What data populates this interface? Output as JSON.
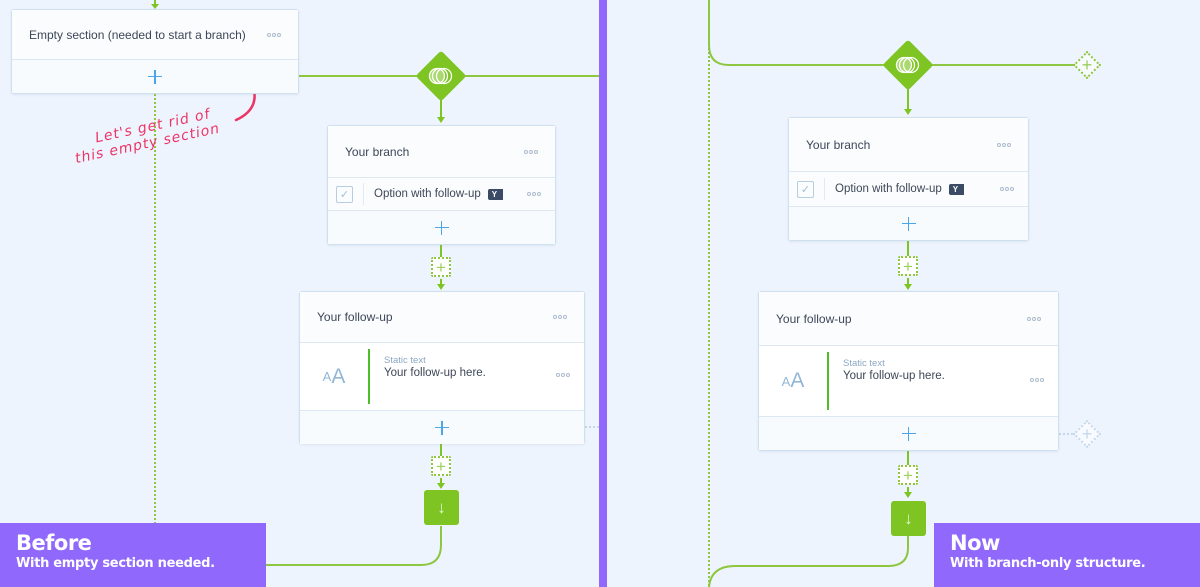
{
  "colors": {
    "background": "#edf4fd",
    "flow_green": "#7ec524",
    "accent_purple": "#9068fb",
    "annotation_pink": "#ec3566",
    "add_blue": "#4aa6e8"
  },
  "before": {
    "empty_section": {
      "title": "Empty section (needed to start a branch)",
      "menu_icon": "more-dots-icon",
      "add_icon": "plus-icon"
    },
    "annotation": {
      "line1": "Let's get rid of",
      "line2": "this empty section"
    },
    "branch_icon": "branch-circles-icon",
    "branch_card": {
      "title": "Your branch",
      "option": {
        "label": "Option with follow-up",
        "badge": "Y",
        "checked": true
      }
    },
    "followup_card": {
      "title": "Your follow-up",
      "block": {
        "type_label": "Static text",
        "value": "Your follow-up here.",
        "icon": "font-size-icon"
      }
    },
    "end_icon": "arrow-down-icon",
    "caption": {
      "title": "Before",
      "subtitle": "With empty section needed."
    }
  },
  "now": {
    "branch_icon": "branch-circles-icon",
    "branch_card": {
      "title": "Your branch",
      "option": {
        "label": "Option with follow-up",
        "badge": "Y",
        "checked": true
      }
    },
    "followup_card": {
      "title": "Your follow-up",
      "block": {
        "type_label": "Static text",
        "value": "Your follow-up here.",
        "icon": "font-size-icon"
      }
    },
    "end_icon": "arrow-down-icon",
    "caption": {
      "title": "Now",
      "subtitle": "With branch-only structure."
    }
  },
  "glyphs": {
    "plus": "+",
    "check": "✓",
    "arrow_down": "↓",
    "aa_small": "A",
    "aa_large": "A"
  }
}
